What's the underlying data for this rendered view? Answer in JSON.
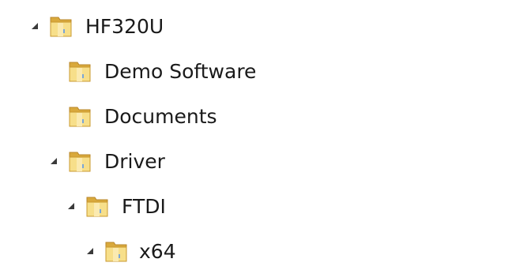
{
  "tree": {
    "nodes": [
      {
        "label": "HF320U",
        "icon": "folder-icon",
        "expanded": true
      },
      {
        "label": "Demo Software",
        "icon": "folder-icon",
        "expanded": false
      },
      {
        "label": "Documents",
        "icon": "folder-icon",
        "expanded": false
      },
      {
        "label": "Driver",
        "icon": "folder-icon",
        "expanded": true
      },
      {
        "label": "FTDI",
        "icon": "folder-icon",
        "expanded": true
      },
      {
        "label": "x64",
        "icon": "folder-icon",
        "expanded": true
      }
    ]
  },
  "colors": {
    "folder_light": "#f7df8a",
    "folder_dark": "#d9a93c",
    "folder_edge": "#b8862a",
    "arrow": "#3a3a3a",
    "text": "#1a1a1a"
  }
}
